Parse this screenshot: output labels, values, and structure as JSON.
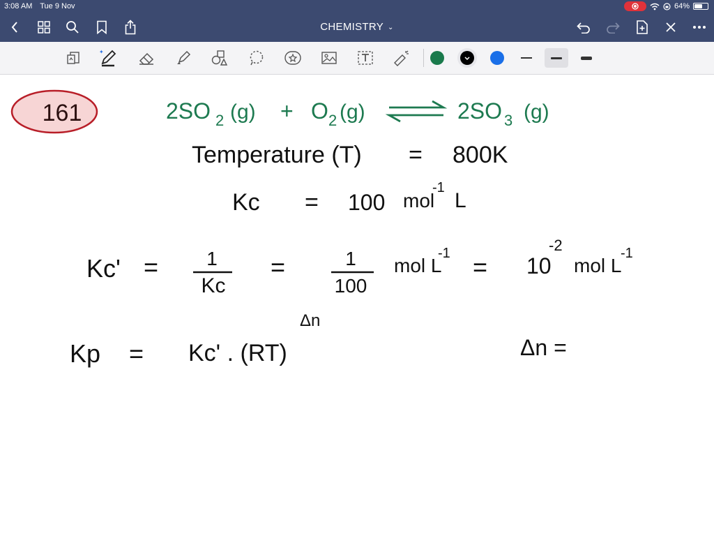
{
  "status": {
    "time": "3:08 AM",
    "date": "Tue 9 Nov",
    "battery": "64%",
    "battery_level": 0.64
  },
  "nav": {
    "title": "CHEMISTRY"
  },
  "toolbar": {
    "colors": [
      "#1a7a4c",
      "#000000",
      "#1a6fe8"
    ]
  },
  "note": {
    "question_number": "161",
    "equation": {
      "lhs1": "2SO",
      "lhs1_sub": "2",
      "lhs1_state": "(g)",
      "plus": "+",
      "lhs2": "O",
      "lhs2_sub": "2",
      "lhs2_state": "(g)",
      "rhs": "2SO",
      "rhs_sub": "3",
      "rhs_state": "(g)"
    },
    "temperature": {
      "label": "Temperature (T)",
      "eq": "=",
      "value": "800K"
    },
    "kc": {
      "label": "Kc",
      "eq": "=",
      "value": "100",
      "unit_a": "mol",
      "unit_a_exp": "-1",
      "unit_b": "L"
    },
    "kc_prime": {
      "lhs": "Kc'",
      "eq1": "=",
      "frac1_num": "1",
      "frac1_den": "Kc",
      "eq2": "=",
      "frac2_num": "1",
      "frac2_den": "100",
      "unit": "mol L",
      "unit_exp": "-1",
      "eq3": "=",
      "result": "10",
      "result_exp": "-2",
      "result_unit": "mol L",
      "result_unit_exp": "-1"
    },
    "kp": {
      "lhs": "Kp",
      "eq": "=",
      "rhs": "Kc' . (RT)",
      "exp": "Δn",
      "delta": "Δn ="
    }
  }
}
